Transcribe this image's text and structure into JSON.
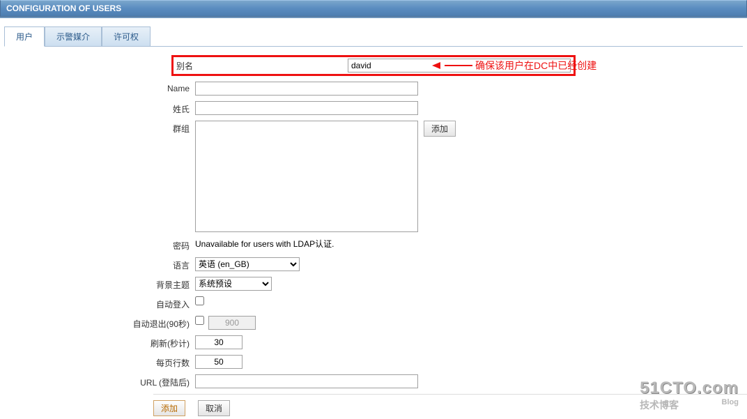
{
  "title": "CONFIGURATION OF USERS",
  "tabs": [
    {
      "label": "用户",
      "active": true
    },
    {
      "label": "示警媒介",
      "active": false
    },
    {
      "label": "许可权",
      "active": false
    }
  ],
  "annotation": "确保该用户在DC中已经创建",
  "form": {
    "alias_label": "别名",
    "alias_value": "david",
    "name_label": "Name",
    "name_value": "",
    "surname_label": "姓氏",
    "surname_value": "",
    "groups_label": "群组",
    "groups_value": "",
    "add_group_btn": "添加",
    "password_label": "密码",
    "password_text": "Unavailable for users with LDAP认证.",
    "language_label": "语言",
    "language_value": "英语 (en_GB)",
    "theme_label": "背景主题",
    "theme_value": "系统预设",
    "autologin_label": "自动登入",
    "autologin_checked": false,
    "autologout_label": "自动退出(90秒)",
    "autologout_checked": false,
    "autologout_value": "900",
    "refresh_label": "刷新(秒计)",
    "refresh_value": "30",
    "rows_label": "每页行数",
    "rows_value": "50",
    "url_label": "URL (登陆后)",
    "url_value": ""
  },
  "bottom": {
    "add": "添加",
    "cancel": "取消"
  },
  "watermark": {
    "line1": "51CTO.com",
    "line2a": "技术博客",
    "line2b": "Blog"
  }
}
